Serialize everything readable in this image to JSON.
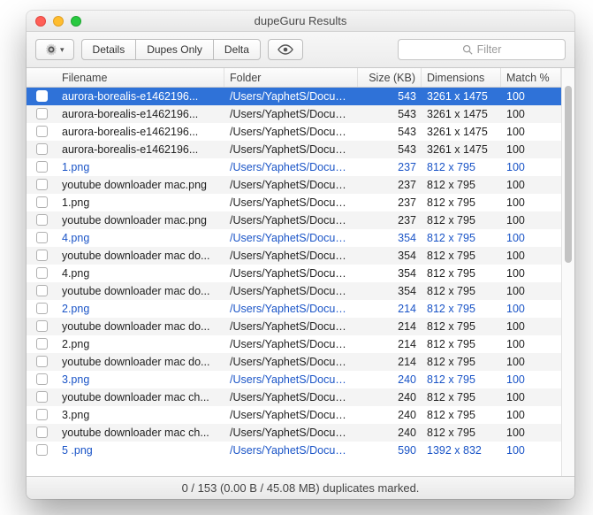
{
  "window": {
    "title": "dupeGuru Results"
  },
  "toolbar": {
    "details": "Details",
    "dupes_only": "Dupes Only",
    "delta": "Delta",
    "search_placeholder": "Filter"
  },
  "columns": {
    "filename": "Filename",
    "folder": "Folder",
    "size": "Size (KB)",
    "dimensions": "Dimensions",
    "match": "Match %"
  },
  "rows": [
    {
      "ref": true,
      "selected": true,
      "filename": "aurora-borealis-e1462196...",
      "folder": "/Users/YaphetS/Docume...",
      "size": "543",
      "dimensions": "3261 x 1475",
      "match": "100"
    },
    {
      "ref": false,
      "selected": false,
      "filename": "aurora-borealis-e1462196...",
      "folder": "/Users/YaphetS/Docume...",
      "size": "543",
      "dimensions": "3261 x 1475",
      "match": "100"
    },
    {
      "ref": false,
      "selected": false,
      "filename": "aurora-borealis-e1462196...",
      "folder": "/Users/YaphetS/Docume...",
      "size": "543",
      "dimensions": "3261 x 1475",
      "match": "100"
    },
    {
      "ref": false,
      "selected": false,
      "filename": "aurora-borealis-e1462196...",
      "folder": "/Users/YaphetS/Docume...",
      "size": "543",
      "dimensions": "3261 x 1475",
      "match": "100"
    },
    {
      "ref": true,
      "selected": false,
      "filename": "1.png",
      "folder": "/Users/YaphetS/Docume...",
      "size": "237",
      "dimensions": "812 x 795",
      "match": "100"
    },
    {
      "ref": false,
      "selected": false,
      "filename": "youtube downloader mac.png",
      "folder": "/Users/YaphetS/Docume...",
      "size": "237",
      "dimensions": "812 x 795",
      "match": "100"
    },
    {
      "ref": false,
      "selected": false,
      "filename": "1.png",
      "folder": "/Users/YaphetS/Docume...",
      "size": "237",
      "dimensions": "812 x 795",
      "match": "100"
    },
    {
      "ref": false,
      "selected": false,
      "filename": "youtube downloader mac.png",
      "folder": "/Users/YaphetS/Docume...",
      "size": "237",
      "dimensions": "812 x 795",
      "match": "100"
    },
    {
      "ref": true,
      "selected": false,
      "filename": "4.png",
      "folder": "/Users/YaphetS/Docume...",
      "size": "354",
      "dimensions": "812 x 795",
      "match": "100"
    },
    {
      "ref": false,
      "selected": false,
      "filename": "youtube downloader mac do...",
      "folder": "/Users/YaphetS/Docume...",
      "size": "354",
      "dimensions": "812 x 795",
      "match": "100"
    },
    {
      "ref": false,
      "selected": false,
      "filename": "4.png",
      "folder": "/Users/YaphetS/Docume...",
      "size": "354",
      "dimensions": "812 x 795",
      "match": "100"
    },
    {
      "ref": false,
      "selected": false,
      "filename": "youtube downloader mac do...",
      "folder": "/Users/YaphetS/Docume...",
      "size": "354",
      "dimensions": "812 x 795",
      "match": "100"
    },
    {
      "ref": true,
      "selected": false,
      "filename": "2.png",
      "folder": "/Users/YaphetS/Docume...",
      "size": "214",
      "dimensions": "812 x 795",
      "match": "100"
    },
    {
      "ref": false,
      "selected": false,
      "filename": "youtube downloader mac do...",
      "folder": "/Users/YaphetS/Docume...",
      "size": "214",
      "dimensions": "812 x 795",
      "match": "100"
    },
    {
      "ref": false,
      "selected": false,
      "filename": "2.png",
      "folder": "/Users/YaphetS/Docume...",
      "size": "214",
      "dimensions": "812 x 795",
      "match": "100"
    },
    {
      "ref": false,
      "selected": false,
      "filename": "youtube downloader mac do...",
      "folder": "/Users/YaphetS/Docume...",
      "size": "214",
      "dimensions": "812 x 795",
      "match": "100"
    },
    {
      "ref": true,
      "selected": false,
      "filename": "3.png",
      "folder": "/Users/YaphetS/Docume...",
      "size": "240",
      "dimensions": "812 x 795",
      "match": "100"
    },
    {
      "ref": false,
      "selected": false,
      "filename": "youtube downloader mac ch...",
      "folder": "/Users/YaphetS/Docume...",
      "size": "240",
      "dimensions": "812 x 795",
      "match": "100"
    },
    {
      "ref": false,
      "selected": false,
      "filename": "3.png",
      "folder": "/Users/YaphetS/Docume...",
      "size": "240",
      "dimensions": "812 x 795",
      "match": "100"
    },
    {
      "ref": false,
      "selected": false,
      "filename": "youtube downloader mac ch...",
      "folder": "/Users/YaphetS/Docume...",
      "size": "240",
      "dimensions": "812 x 795",
      "match": "100"
    },
    {
      "ref": true,
      "selected": false,
      "filename": "5 .png",
      "folder": "/Users/YaphetS/Docume...",
      "size": "590",
      "dimensions": "1392 x 832",
      "match": "100"
    }
  ],
  "status": "0 / 153 (0.00 B / 45.08 MB) duplicates marked."
}
